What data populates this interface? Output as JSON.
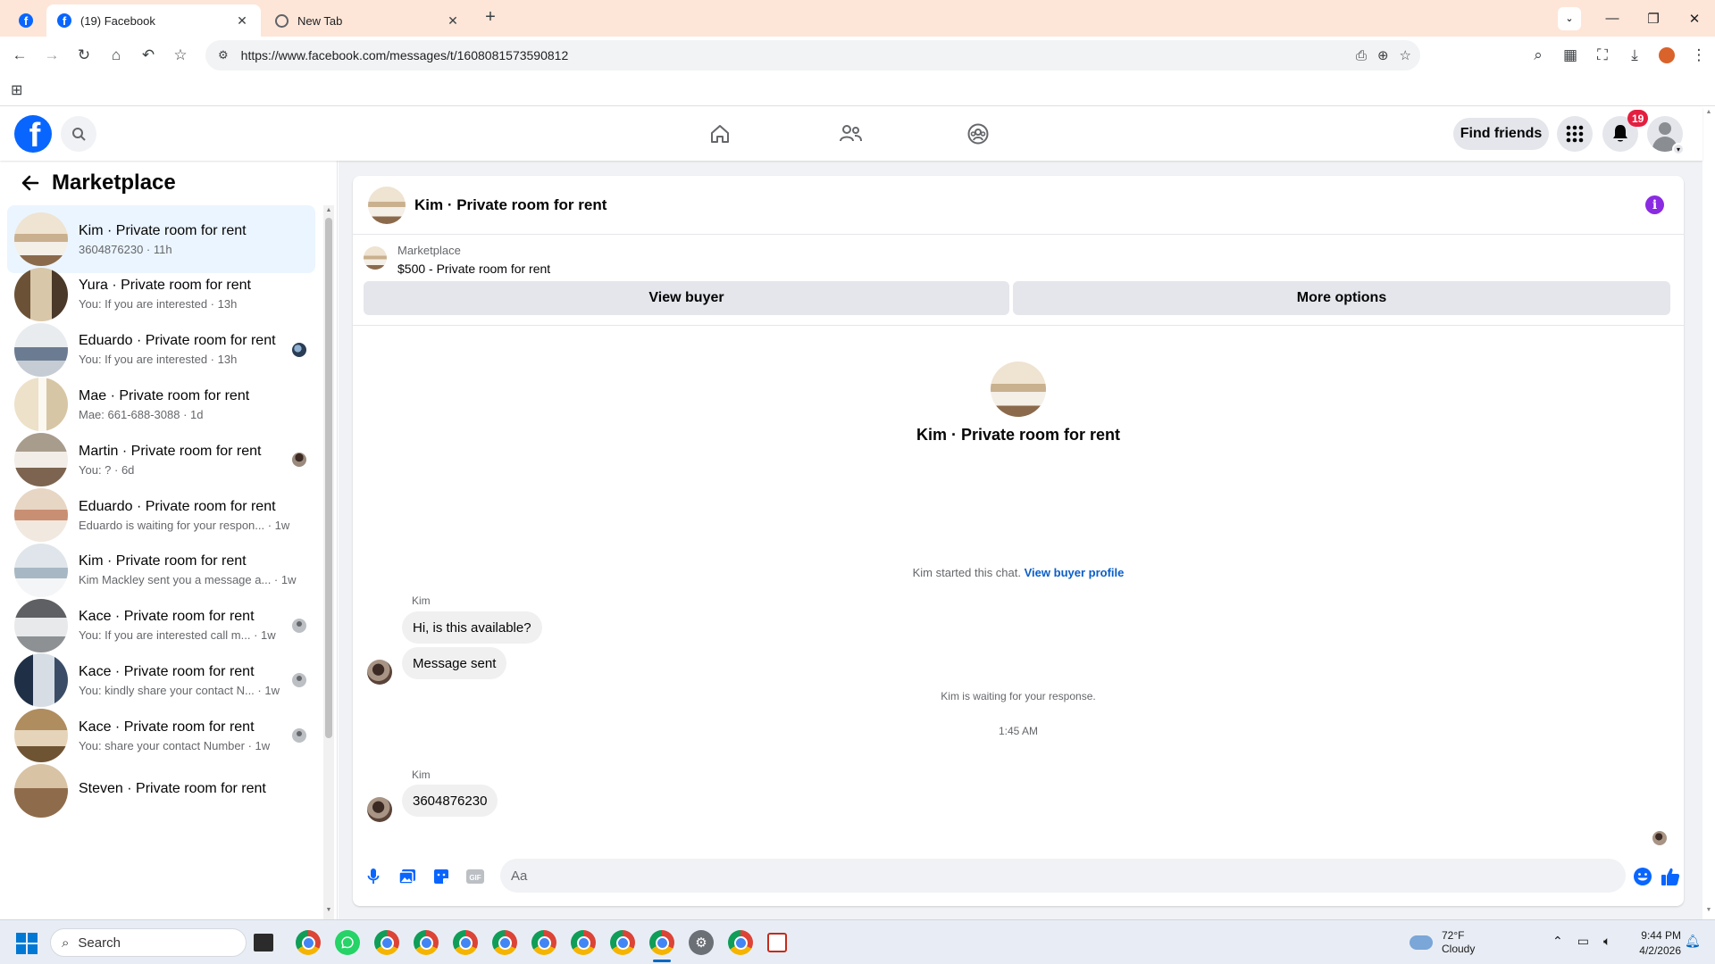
{
  "browser": {
    "tabs": [
      {
        "title": "(19) Facebook",
        "active": true
      },
      {
        "title": "New Tab",
        "active": false
      }
    ],
    "url": "https://www.facebook.com/messages/t/1608081573590812"
  },
  "header": {
    "find_friends": "Find friends",
    "notification_count": "19"
  },
  "sidebar": {
    "title": "Marketplace",
    "conversations": [
      {
        "title": "Kim · Private room for rent",
        "subtitle": "3604876230 · 11h",
        "active": true,
        "read": "none"
      },
      {
        "title": "Yura · Private room for rent",
        "subtitle": "You: If you are interested · 13h",
        "active": false,
        "read": "none"
      },
      {
        "title": "Eduardo · Private room for rent",
        "subtitle": "You: If you are interested · 13h",
        "active": false,
        "read": "eduardo"
      },
      {
        "title": "Mae · Private room for rent",
        "subtitle": "Mae: 661-688-3088 · 1d",
        "active": false,
        "read": "none"
      },
      {
        "title": "Martin · Private room for rent",
        "subtitle": "You: ? · 6d",
        "active": false,
        "read": "photo"
      },
      {
        "title": "Eduardo · Private room for rent",
        "subtitle": "Eduardo is waiting for your respon... · 1w",
        "active": false,
        "read": "none"
      },
      {
        "title": "Kim · Private room for rent",
        "subtitle": "Kim Mackley sent you a message a... · 1w",
        "active": false,
        "read": "none"
      },
      {
        "title": "Kace · Private room for rent",
        "subtitle": "You: If you are interested call m... · 1w",
        "active": false,
        "read": "default"
      },
      {
        "title": "Kace · Private room for rent",
        "subtitle": "You: kindly share your contact N... · 1w",
        "active": false,
        "read": "default"
      },
      {
        "title": "Kace · Private room for rent",
        "subtitle": "You: share your contact Number · 1w",
        "active": false,
        "read": "default"
      },
      {
        "title": "Steven · Private room for rent",
        "subtitle": "",
        "active": false,
        "read": "none"
      }
    ]
  },
  "chat": {
    "title": "Kim · Private room for rent",
    "listing": {
      "label": "Marketplace",
      "price_title": "$500 - Private room for rent",
      "view_buyer": "View buyer",
      "more_options": "More options"
    },
    "intro_title": "Kim · Private room for rent",
    "started_text": "Kim started this chat.",
    "started_link": "View buyer profile",
    "messages": [
      {
        "sender": "Kim",
        "bubbles": [
          "Hi, is this available?",
          "Message sent"
        ]
      },
      {
        "sender": "Kim",
        "bubbles": [
          "3604876230"
        ]
      }
    ],
    "waiting_text": "Kim is waiting for your response.",
    "timestamp": "1:45 AM",
    "composer_placeholder": "Aa"
  },
  "taskbar": {
    "search_placeholder": "Search",
    "weather_temp": "72°F",
    "weather_desc": "Cloudy",
    "time": "9:44 PM",
    "date": "4/2/2026"
  },
  "colors": {
    "fb_blue": "#0866ff",
    "badge_red": "#e41e3f",
    "active_conv": "#ebf5ff",
    "tabbar_bg": "#fde6d8",
    "info_purple": "#8a2be2"
  }
}
